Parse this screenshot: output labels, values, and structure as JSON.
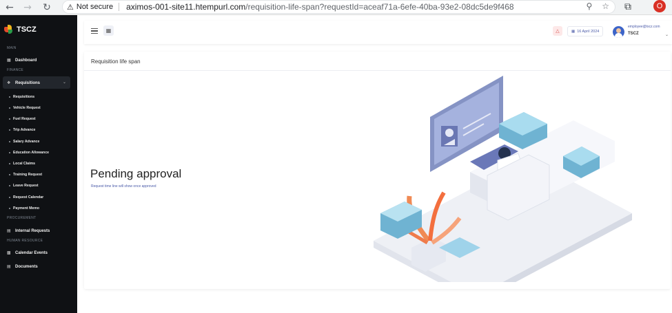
{
  "browser": {
    "security_label": "Not secure",
    "url_host": "aximos-001-site11.htempurl.com",
    "url_rest": "/requisition-life-span?requestId=aceaf71a-6efe-40ba-93e2-08dc5de9f468",
    "profile_initial": "O"
  },
  "sidebar": {
    "brand": "TSCZ",
    "sections": {
      "main": "MAIN",
      "finance": "FINANCE",
      "procurement": "PROCUREMENT",
      "human_resource": "HUMAN RESOURCE"
    },
    "dashboard": "Dashboard",
    "requisitions_group": "Requisitions",
    "submenu": [
      "Requisitions",
      "Vehicle Request",
      "Fuel Request",
      "Trip Advance",
      "Salary Advance",
      "Education Allowance",
      "Local Claims",
      "Training Request",
      "Leave Request",
      "Request Calendar",
      "Payment Memo"
    ],
    "internal_requests": "Internal Requests",
    "calendar_events": "Calendar Events",
    "documents": "Documents"
  },
  "topbar": {
    "date": "16 April 2024",
    "user_email": "employee@tscz.com",
    "user_name": "TSCZ"
  },
  "main": {
    "card_title": "Requisition life span",
    "status_heading": "Pending approval",
    "status_subtext": "Request time line will show once approved"
  }
}
